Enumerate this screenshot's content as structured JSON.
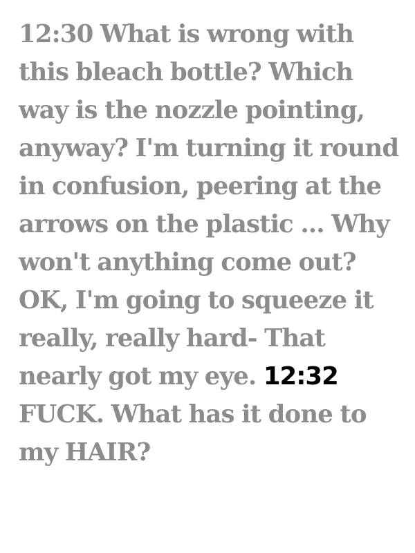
{
  "passage": {
    "time_start": "12:30",
    "text_part_1": " What is wrong with this bleach bottle? Which way is the nozzle pointing, anyway? I'm turning it round in confusion, peering at the arrows on the plastic ... Why won't anything come out? OK, I'm going to squeeze it really, really hard- That nearly got my eye. ",
    "time_highlight": "12:32",
    "text_part_2": " FUCK. What has it done to my HAIR?"
  },
  "colors": {
    "text": "#8c8c8c",
    "highlight": "#000000",
    "background": "#ffffff"
  }
}
